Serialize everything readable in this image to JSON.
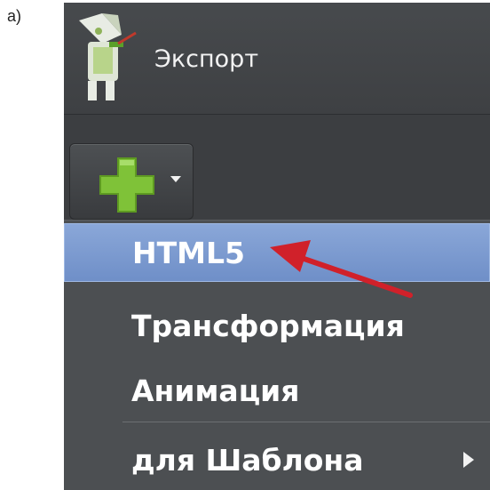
{
  "figure_label": "a)",
  "header": {
    "title": "Экспорт",
    "logo_icon": "export-wizard-icon"
  },
  "toolbar": {
    "add_button_icon": "plus-icon",
    "dropdown_icon": "chevron-down-icon"
  },
  "menu": {
    "items": [
      {
        "label": "HTML5",
        "selected": true
      },
      {
        "label": "Трансформация",
        "selected": false
      },
      {
        "label": "Анимация",
        "selected": false
      },
      {
        "label": "для Шаблона",
        "selected": false,
        "has_submenu": true
      }
    ]
  },
  "annotation": {
    "type": "red-arrow",
    "points_to": "HTML5",
    "color": "#d0212a"
  },
  "colors": {
    "panel": "#3c3e41",
    "selected": "#7b9ad0",
    "plus": "#7fc238",
    "arrow": "#d0212a"
  }
}
